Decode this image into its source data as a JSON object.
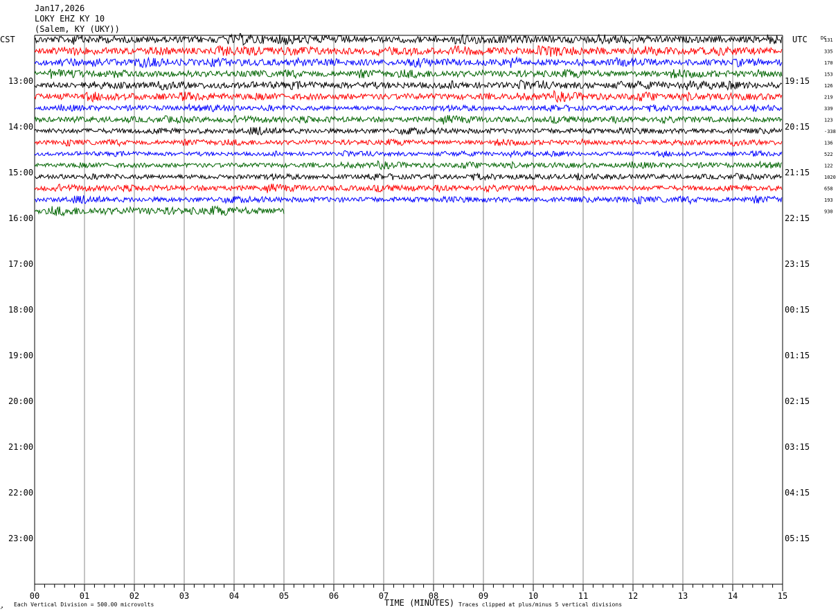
{
  "header": {
    "date": "Jan17,2026",
    "station": "LOKY EHZ KY 10",
    "location": "(Salem, KY (UKY))"
  },
  "axes": {
    "left_timezone": "CST",
    "right_timezone": "UTC",
    "dc_label": "DC",
    "xlabel": "TIME (MINUTES)",
    "x_ticks": [
      "00",
      "01",
      "02",
      "03",
      "04",
      "05",
      "06",
      "07",
      "08",
      "09",
      "10",
      "11",
      "12",
      "13",
      "14",
      "15"
    ],
    "left_hour_labels": [
      "13:00",
      "14:00",
      "15:00",
      "16:00",
      "17:00",
      "18:00",
      "19:00",
      "20:00",
      "21:00",
      "22:00",
      "23:00"
    ],
    "right_hour_labels": [
      "19:15",
      "20:15",
      "21:15",
      "22:15",
      "23:15",
      "00:15",
      "01:15",
      "02:15",
      "03:15",
      "04:15",
      "05:15"
    ]
  },
  "footer": {
    "scale_note": "Each Vertical Division =  500.00 microvolts",
    "clip_note": "Traces clipped at plus/minus 5 vertical divisions",
    "corner_mark": "↗"
  },
  "chart_data": {
    "type": "line",
    "title": "LOKY EHZ KY 10",
    "xlabel": "TIME (MINUTES)",
    "xlim": [
      0,
      15
    ],
    "grid": true,
    "colors": [
      "#000000",
      "#ff0000",
      "#0000ff",
      "#006400"
    ],
    "traces": [
      {
        "dc": "131",
        "color": "#000000",
        "amp": 4.5,
        "end_min": 15
      },
      {
        "dc": "335",
        "color": "#ff0000",
        "amp": 4.5,
        "end_min": 15
      },
      {
        "dc": "170",
        "color": "#0000ff",
        "amp": 4.0,
        "end_min": 15
      },
      {
        "dc": "153",
        "color": "#006400",
        "amp": 4.0,
        "end_min": 15
      },
      {
        "dc": "126",
        "color": "#000000",
        "amp": 4.0,
        "end_min": 15
      },
      {
        "dc": "219",
        "color": "#ff0000",
        "amp": 4.0,
        "end_min": 15
      },
      {
        "dc": "339",
        "color": "#0000ff",
        "amp": 3.0,
        "end_min": 15
      },
      {
        "dc": "123",
        "color": "#006400",
        "amp": 3.5,
        "end_min": 15
      },
      {
        "dc": "-338",
        "color": "#000000",
        "amp": 3.5,
        "end_min": 15
      },
      {
        "dc": "136",
        "color": "#ff0000",
        "amp": 3.0,
        "end_min": 15
      },
      {
        "dc": "522",
        "color": "#0000ff",
        "amp": 2.5,
        "end_min": 15
      },
      {
        "dc": "122",
        "color": "#006400",
        "amp": 3.0,
        "end_min": 15
      },
      {
        "dc": "1020",
        "color": "#000000",
        "amp": 3.0,
        "end_min": 15
      },
      {
        "dc": "658",
        "color": "#ff0000",
        "amp": 3.5,
        "end_min": 15
      },
      {
        "dc": "193",
        "color": "#0000ff",
        "amp": 3.5,
        "end_min": 15
      },
      {
        "dc": "930",
        "color": "#006400",
        "amp": 4.5,
        "end_min": 5
      }
    ]
  }
}
